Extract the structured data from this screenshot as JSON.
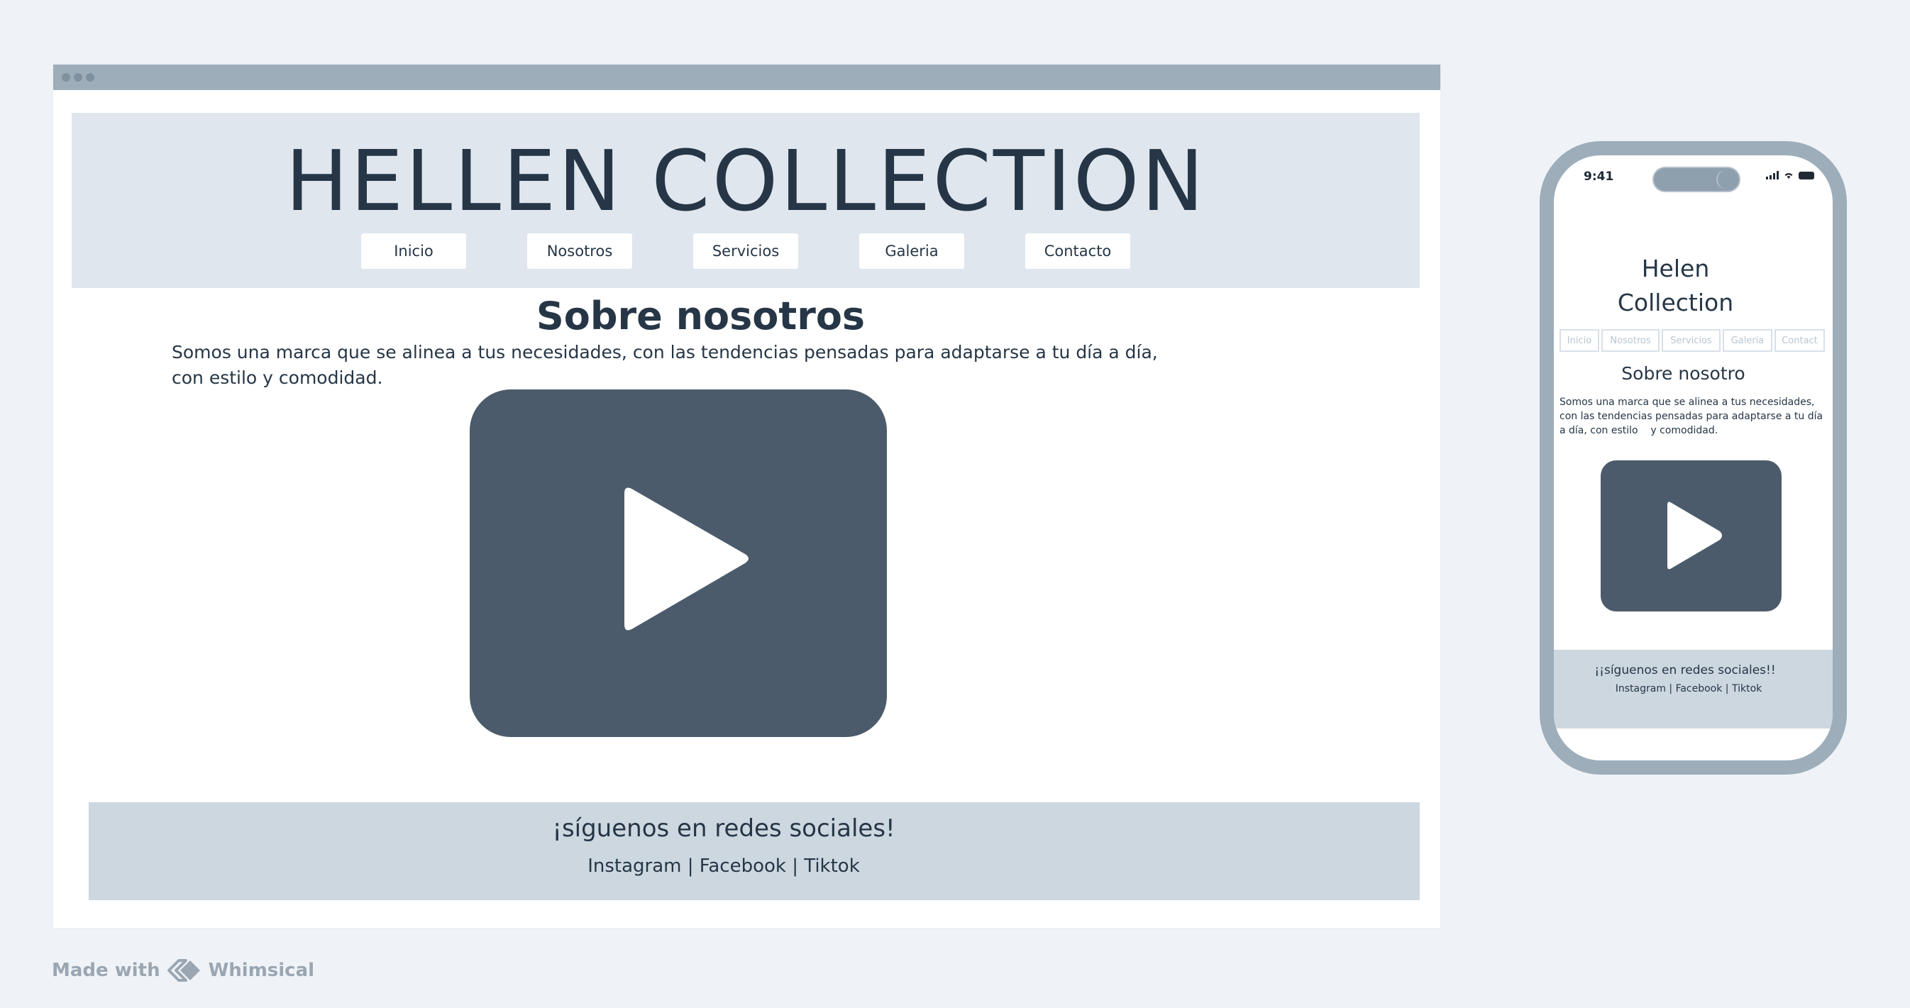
{
  "desktop": {
    "title": "HELLEN COLLECTION",
    "nav": [
      "Inicio",
      "Nosotros",
      "Servicios",
      "Galeria",
      "Contacto"
    ],
    "about_title": "Sobre nosotros",
    "about_text": "Somos una marca que se alinea a tus necesidades, con las tendencias pensadas para adaptarse a tu día a día, con estilo y comodidad.",
    "video_icon": "play-icon",
    "footer_title": "¡síguenos en redes sociales!",
    "footer_links": "Instagram | Facebook | Tiktok"
  },
  "mobile": {
    "time": "9:41",
    "title_line1": "Helen",
    "title_line2": "Collection",
    "nav": [
      "Inicio",
      "Nosotros",
      "Servicios",
      "Galeria",
      "Contact"
    ],
    "about_title": "Sobre nosotro",
    "about_text": "Somos una marca que se alinea a tus necesidades, con las tendencias pensadas para adaptarse a tu día a día, con estilo    y comodidad.",
    "video_icon": "play-icon",
    "footer_title": "¡¡síguenos en redes sociales!!",
    "footer_links": "Instagram | Facebook | Tiktok"
  },
  "branding": {
    "made_with": "Made with",
    "brand": "Whimsical"
  },
  "colors": {
    "background": "#eff3f7",
    "header_bg": "#dfe6ee",
    "footer_bg": "#cdd7e0",
    "frame": "#9dadba",
    "video": "#4b5b6b",
    "text": "#263646"
  }
}
